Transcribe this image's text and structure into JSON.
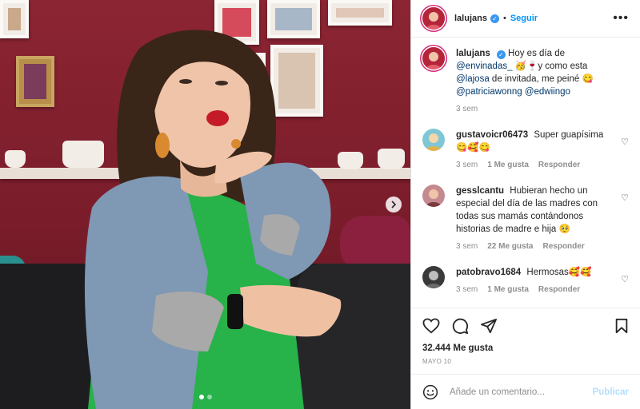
{
  "header": {
    "username": "lalujans",
    "follow_label": "Seguir",
    "separator": "•",
    "more": "•••"
  },
  "caption": {
    "username": "lalujans",
    "segments": [
      {
        "text": "Hoy es día de ",
        "type": "text"
      },
      {
        "text": "@envinadas_",
        "type": "mention"
      },
      {
        "text": " 🥳🍷y como esta ",
        "type": "text"
      },
      {
        "text": "@lajosa",
        "type": "mention"
      },
      {
        "text": " de invitada, me peiné 😋",
        "type": "text"
      }
    ],
    "mentions_line": [
      "@patriciawonng",
      "@edwiingo"
    ],
    "time": "3 sem"
  },
  "comments": [
    {
      "username": "gustavoicr06473",
      "text": "Super guapísima 😋🥰😋",
      "time": "3 sem",
      "likes": "1 Me gusta",
      "reply": "Responder",
      "avatar_color": "#7fc7d6"
    },
    {
      "username": "gesslcantu",
      "text": "Hubieran hecho un especial del día de las madres con todas sus mamás contándonos historias de madre e hija 🥺",
      "time": "3 sem",
      "likes": "22 Me gusta",
      "reply": "Responder",
      "avatar_color": "#c48a8f"
    },
    {
      "username": "patobravo1684",
      "text": "Hermosas🥰🥰",
      "time": "3 sem",
      "likes": "1 Me gusta",
      "reply": "Responder",
      "avatar_color": "#3a3a3a"
    }
  ],
  "stats": {
    "likes": "32.444 Me gusta",
    "date": "MAYO 10"
  },
  "composer": {
    "placeholder": "Añade un comentario...",
    "publish_label": "Publicar"
  },
  "icons": {
    "heart": "heart-icon",
    "comment": "comment-icon",
    "share": "share-icon",
    "save": "bookmark-icon",
    "emoji": "emoji-icon",
    "next": "chevron-right-icon"
  },
  "colors": {
    "accent": "#0095f6",
    "mention": "#00376b",
    "muted": "#8e8e8e",
    "verified": "#3897f0",
    "publish_disabled": "#b2dffc",
    "wall": "#8c2533"
  },
  "carousel": {
    "slide_count": 2,
    "active_index": 0
  }
}
